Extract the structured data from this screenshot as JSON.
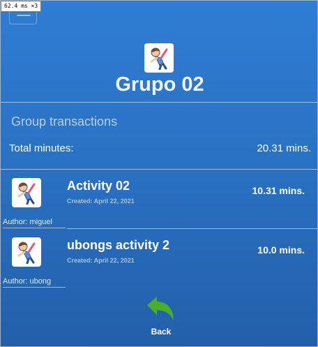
{
  "perf": "62.4 ms ×3",
  "header": {
    "menu_icon": "hamburger-menu-icon",
    "group_title": "Grupo 02",
    "group_icon": "person-stretching-icon"
  },
  "section_title": "Group transactions",
  "totals": {
    "label": "Total minutes:",
    "value": "20.31 mins."
  },
  "activities": [
    {
      "name": "Activity 02",
      "created": "Created: April 22, 2021",
      "minutes": "10.31  mins.",
      "author": "Author: miguel",
      "icon": "person-stretching-icon"
    },
    {
      "name": "ubongs activity 2",
      "created": "Created: April 22, 2021",
      "minutes": "10.0  mins.",
      "author": "Author: ubong",
      "icon": "person-stretching-icon"
    }
  ],
  "back": {
    "label": "Back",
    "icon": "back-arrow-icon",
    "color": "#4caf2a"
  },
  "colors": {
    "background": "#2a72c4",
    "section_title": "#b9cfe8"
  }
}
